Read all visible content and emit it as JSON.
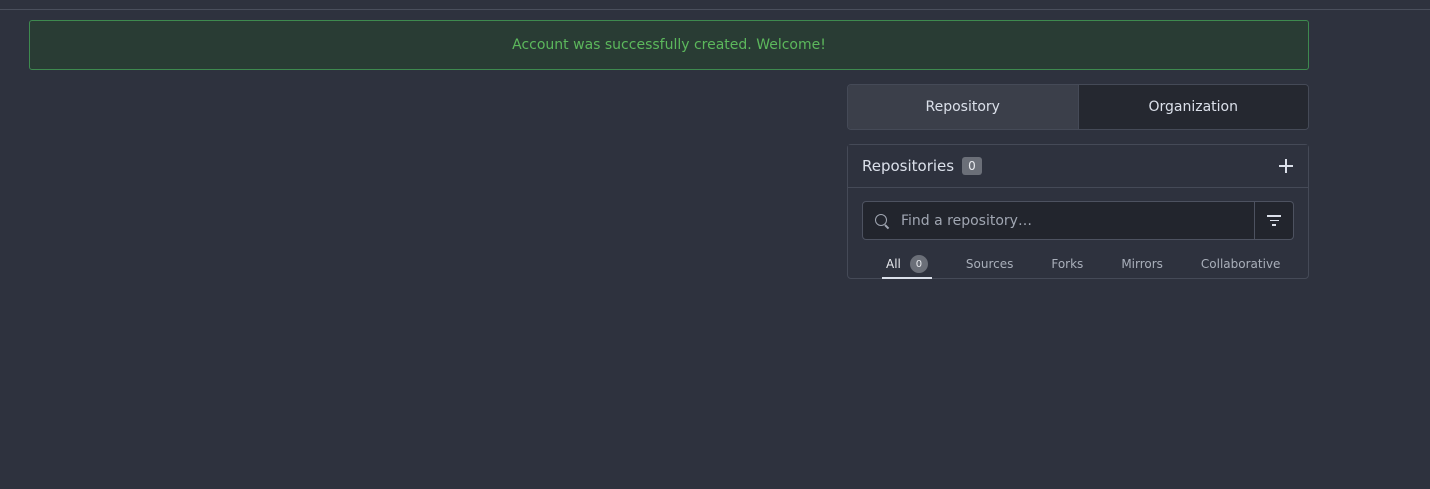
{
  "flash": {
    "message": "Account was successfully created. Welcome!"
  },
  "context_switch": {
    "repository_label": "Repository",
    "organization_label": "Organization"
  },
  "repos_panel": {
    "title": "Repositories",
    "count": "0",
    "search": {
      "placeholder": "Find a repository…",
      "value": ""
    },
    "filters": [
      {
        "label": "All",
        "count": "0"
      },
      {
        "label": "Sources"
      },
      {
        "label": "Forks"
      },
      {
        "label": "Mirrors"
      },
      {
        "label": "Collaborative"
      }
    ]
  },
  "colors": {
    "background": "#2e323e",
    "success_text": "#5cb85c",
    "success_bg": "#293c34"
  }
}
